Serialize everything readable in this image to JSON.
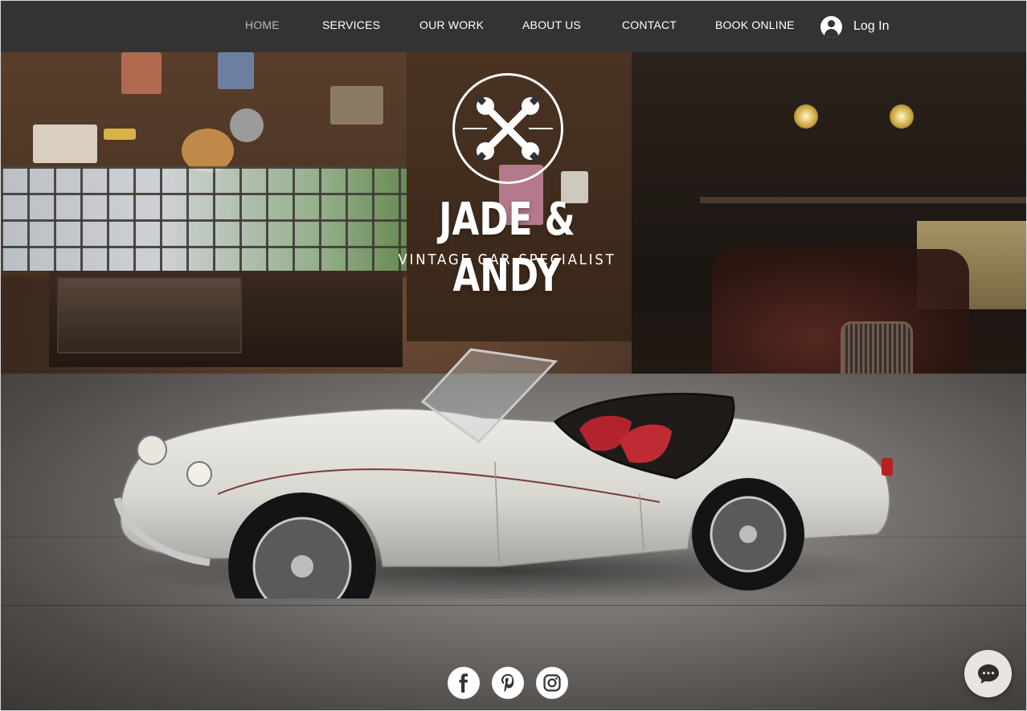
{
  "nav": {
    "items": [
      {
        "label": "HOME",
        "active": true
      },
      {
        "label": "SERVICES",
        "active": false
      },
      {
        "label": "OUR WORK",
        "active": false
      },
      {
        "label": "ABOUT US",
        "active": false
      },
      {
        "label": "CONTACT",
        "active": false
      },
      {
        "label": "BOOK ONLINE",
        "active": false
      }
    ],
    "login_label": "Log In",
    "login_icon": "user-avatar-icon"
  },
  "hero": {
    "emblem_icon": "crossed-wrenches-icon",
    "title": "JADE & ANDY",
    "subtitle": "VINTAGE CAR SPECIALIST"
  },
  "social": [
    {
      "name": "facebook",
      "icon": "facebook-icon"
    },
    {
      "name": "pinterest",
      "icon": "pinterest-icon"
    },
    {
      "name": "instagram",
      "icon": "instagram-icon"
    }
  ],
  "chat": {
    "icon": "chat-bubble-icon"
  },
  "colors": {
    "nav_bg": "#333333",
    "nav_text": "#ffffff",
    "nav_active": "#b8b8b8",
    "social_bg": "#ffffff",
    "social_icon": "#333333",
    "chat_bg": "#e9e4e1"
  }
}
